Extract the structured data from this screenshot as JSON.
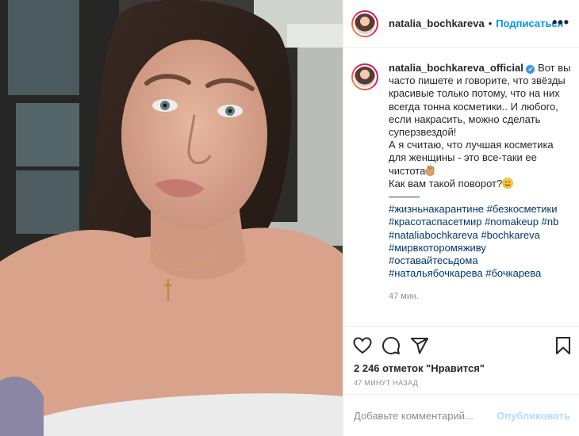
{
  "post": {
    "author": "natalia_bochkareva",
    "follow_separator": "•",
    "follow_label": "Подписаться",
    "more_label": "•••"
  },
  "caption": {
    "author": "natalia_bochkareva_official",
    "verified_mark": "✔",
    "text_lines": [
      "Вот вы",
      "часто пишете и говорите, что звёзды",
      "красивые только потому, что на них",
      "всегда тонна косметики.. И любого,",
      "если накрасить, можно сделать",
      "суперзвездой!",
      "А я считаю, что лучшая косметика",
      "для женщины - это все-таки ее",
      "чистота",
      "Как вам такой поворот?",
      "———"
    ],
    "hashtags": [
      "#жизньнакарантине #безкосметики",
      "#красотаспасетмир #nomakeup #nb",
      "#nataliabochkareva #bochkareva",
      "#мирвкоторомяживу",
      "#оставайтесьдома",
      "#натальябочкарева #бочкарева"
    ],
    "time": "47 мин."
  },
  "engagement": {
    "likes": "2 246 отметок \"Нравится\"",
    "posted_ago": "47 МИНУТ НАЗАД"
  },
  "comment": {
    "placeholder": "Добавьте комментарий...",
    "publish_label": "Опубликовать"
  },
  "icons": {
    "like": "heart-icon",
    "comment": "comment-icon",
    "share": "share-icon",
    "save": "bookmark-icon"
  },
  "colors": {
    "link": "#0095f6",
    "hashtag": "#00376b",
    "muted": "#8e8e8e",
    "publish_disabled": "#b3dbff",
    "verified": "#3897f0"
  }
}
